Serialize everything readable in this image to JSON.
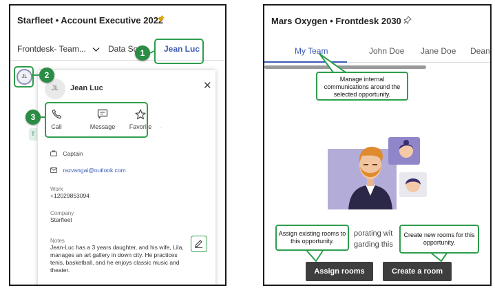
{
  "left": {
    "title": "Starfleet • Account Executive 2022",
    "tabs": [
      "Frontdesk- Team...",
      "Data So",
      "Jean Luc"
    ],
    "avatar_initials": "JL",
    "card": {
      "initials": "JL",
      "name": "Jean Luc",
      "close_glyph": "✕",
      "actions": [
        {
          "label": "Call",
          "icon": "phone-icon"
        },
        {
          "label": "Message",
          "icon": "message-icon"
        },
        {
          "label": "Favorite",
          "icon": "star-icon"
        }
      ],
      "dot": ".",
      "stub_text": "T",
      "role": "Captain",
      "email": "razvangai@outlook.com",
      "work_label": "Work",
      "work_value": "+12029853094",
      "company_label": "Company",
      "company_value": "Starfleet",
      "notes_label": "Notes",
      "notes_value": "Jean-Luc has a 3 years daughter, and his wife, Lila, manages an art gallery in down city. He practices tenis, basketball, and he enjoys classic music and theater."
    },
    "badges": [
      "1",
      "2",
      "3"
    ]
  },
  "right": {
    "title": "Mars Oxygen • Frontdesk 2030",
    "tabs": [
      "My Team",
      "John Doe",
      "Jane Doe",
      "Dean"
    ],
    "tooltip_team": "Manage internal communications around the selected opportunity.",
    "body_line1": "porating wit",
    "body_line2": "garding this",
    "tooltip_assign": "Assign existing rooms to this opportunity.",
    "tooltip_create": "Create new rooms for this opportunity.",
    "assign_button": "Assign rooms",
    "create_button": "Create a room"
  },
  "colors": {
    "callout_green": "#2e9d4d",
    "badge_green": "#2b8c45",
    "tab_active_blue": "#3b5bb5",
    "button_dark": "#3e3e3e",
    "illustration_purple": "#b3acd8"
  }
}
